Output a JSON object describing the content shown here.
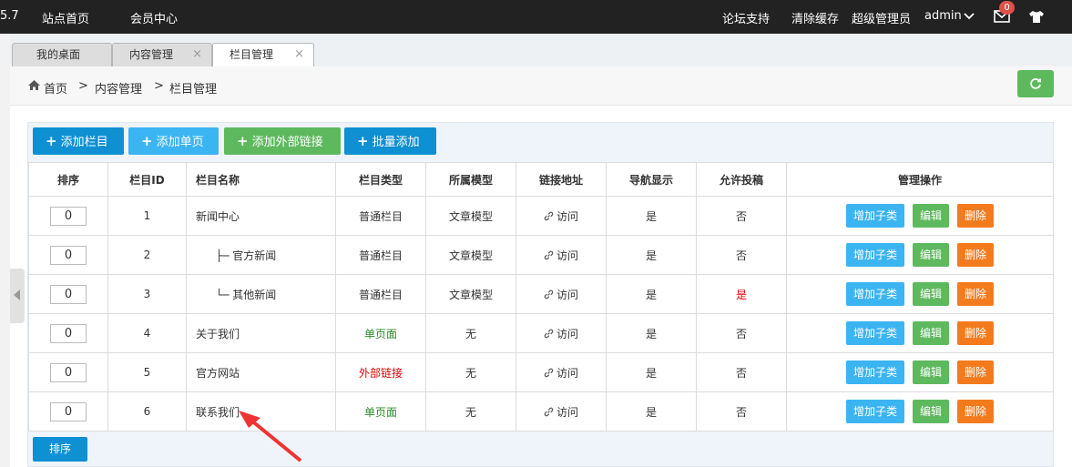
{
  "topbar": {
    "version": "5.7",
    "nav": [
      "站点首页",
      "会员中心"
    ],
    "right": [
      "论坛支持",
      "清除缓存",
      "超级管理员",
      "admin"
    ],
    "mail_badge": "0"
  },
  "tabs": [
    {
      "label": "我的桌面"
    },
    {
      "label": "内容管理",
      "close": "×"
    },
    {
      "label": "栏目管理",
      "close": "×"
    }
  ],
  "breadcrumb": {
    "items": [
      "首页",
      "内容管理",
      "栏目管理"
    ],
    "sep": ">"
  },
  "toolbar": {
    "add_column": "添加栏目",
    "add_page": "添加单页",
    "add_link": "添加外部链接",
    "batch_add": "批量添加"
  },
  "table": {
    "headers": [
      "排序",
      "栏目ID",
      "栏目名称",
      "栏目类型",
      "所属模型",
      "链接地址",
      "导航显示",
      "允许投稿",
      "管理操作"
    ],
    "rows": [
      {
        "sort": "0",
        "id": "1",
        "name": "新闻中心",
        "type": "普通栏目",
        "model": "文章模型",
        "link": "访问",
        "nav": "是",
        "submit": "否"
      },
      {
        "sort": "0",
        "id": "2",
        "name": "├─ 官方新闻",
        "type": "普通栏目",
        "model": "文章模型",
        "link": "访问",
        "nav": "是",
        "submit": "否"
      },
      {
        "sort": "0",
        "id": "3",
        "name": "└─ 其他新闻",
        "type": "普通栏目",
        "model": "文章模型",
        "link": "访问",
        "nav": "是",
        "submit": "是"
      },
      {
        "sort": "0",
        "id": "4",
        "name": "关于我们",
        "type": "单页面",
        "model": "无",
        "link": "访问",
        "nav": "是",
        "submit": "否"
      },
      {
        "sort": "0",
        "id": "5",
        "name": "官方网站",
        "type": "外部链接",
        "model": "无",
        "link": "访问",
        "nav": "是",
        "submit": "否"
      },
      {
        "sort": "0",
        "id": "6",
        "name": "联系我们",
        "type": "单页面",
        "model": "无",
        "link": "访问",
        "nav": "是",
        "submit": "否"
      }
    ],
    "ops": {
      "add_child": "增加子类",
      "edit": "编辑",
      "delete": "删除"
    }
  },
  "sort_button": "排序",
  "colors": {
    "topbar": "#222222",
    "blue": "#0e90d2",
    "light_blue": "#3bb4f2",
    "green": "#5eb95e",
    "orange": "#f37b1d",
    "red": "#dd0000"
  }
}
